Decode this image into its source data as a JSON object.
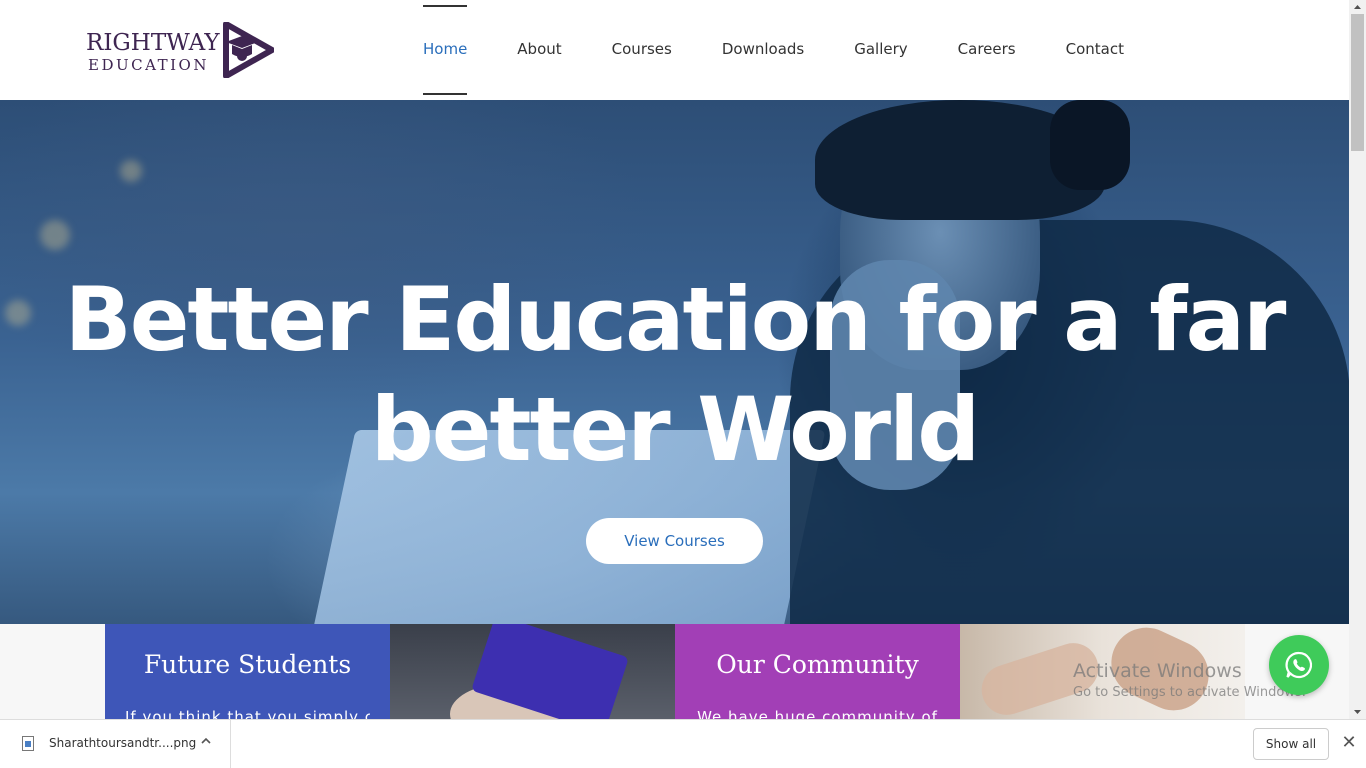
{
  "brand": {
    "line1": "RIGHTWAY",
    "line2": "EDUCATION",
    "primary_color": "#3e2551"
  },
  "nav": {
    "items": [
      {
        "label": "Home",
        "active": true
      },
      {
        "label": "About"
      },
      {
        "label": "Courses"
      },
      {
        "label": "Downloads"
      },
      {
        "label": "Gallery"
      },
      {
        "label": "Careers"
      },
      {
        "label": "Contact"
      }
    ],
    "active_color": "#2a6ebb"
  },
  "hero": {
    "title_line1": "Better Education for a far",
    "title_line2": "better World",
    "cta_label": "View Courses"
  },
  "cards": [
    {
      "title": "Future Students",
      "text": "If you think that you simply can",
      "color": "#3e56b8"
    },
    {
      "title": "",
      "text": ""
    },
    {
      "title": "Our Community",
      "text": "We have huge community of",
      "color": "#a23fb6"
    },
    {
      "title": "",
      "text": ""
    }
  ],
  "watermark": {
    "line1": "Activate Windows",
    "line2": "Go to Settings to activate Windows."
  },
  "whatsapp": {
    "icon": "whatsapp-icon",
    "color": "#3fcb5a"
  },
  "downloads_bar": {
    "file_name": "Sharathtoursandtr....png",
    "show_all": "Show all",
    "close": "✕"
  }
}
